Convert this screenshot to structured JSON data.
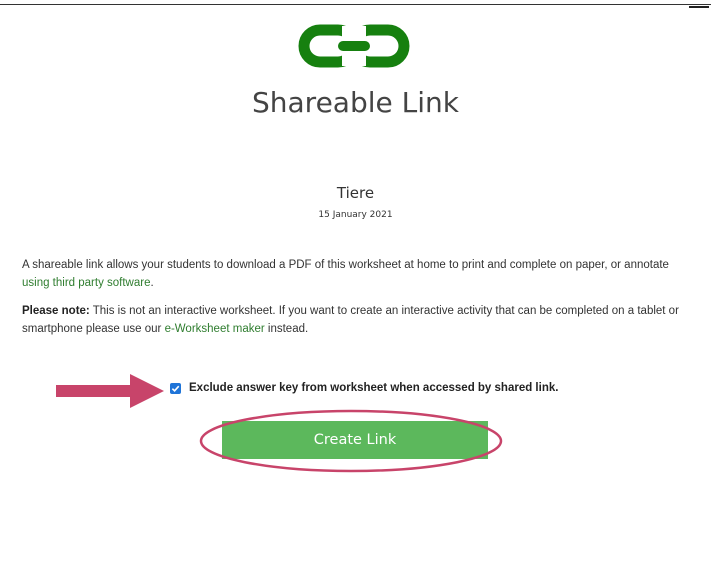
{
  "header": {
    "title": "Shareable Link",
    "logo_icon": "chain-link-icon",
    "logo_color": "#16800f"
  },
  "worksheet": {
    "name": "Tiere",
    "date": "15 January 2021"
  },
  "description": {
    "text": "A shareable link allows your students to download a PDF of this worksheet at home to print and complete on paper, or annotate ",
    "link_label": "using third party software",
    "end": "."
  },
  "note": {
    "label": "Please note:",
    "text": " This is not an interactive worksheet. If you want to create an interactive activity that can be completed on a tablet or smartphone please use our ",
    "link_label": "e-Worksheet maker",
    "end": " instead."
  },
  "options": {
    "exclude_answer_key_label": "Exclude answer key from worksheet when accessed by shared link.",
    "exclude_answer_key_checked": true
  },
  "actions": {
    "create_link_label": "Create Link",
    "button_color": "#5cb85c"
  },
  "annotations": {
    "arrow_color": "#c8446a",
    "circle_color": "#c8446a"
  }
}
